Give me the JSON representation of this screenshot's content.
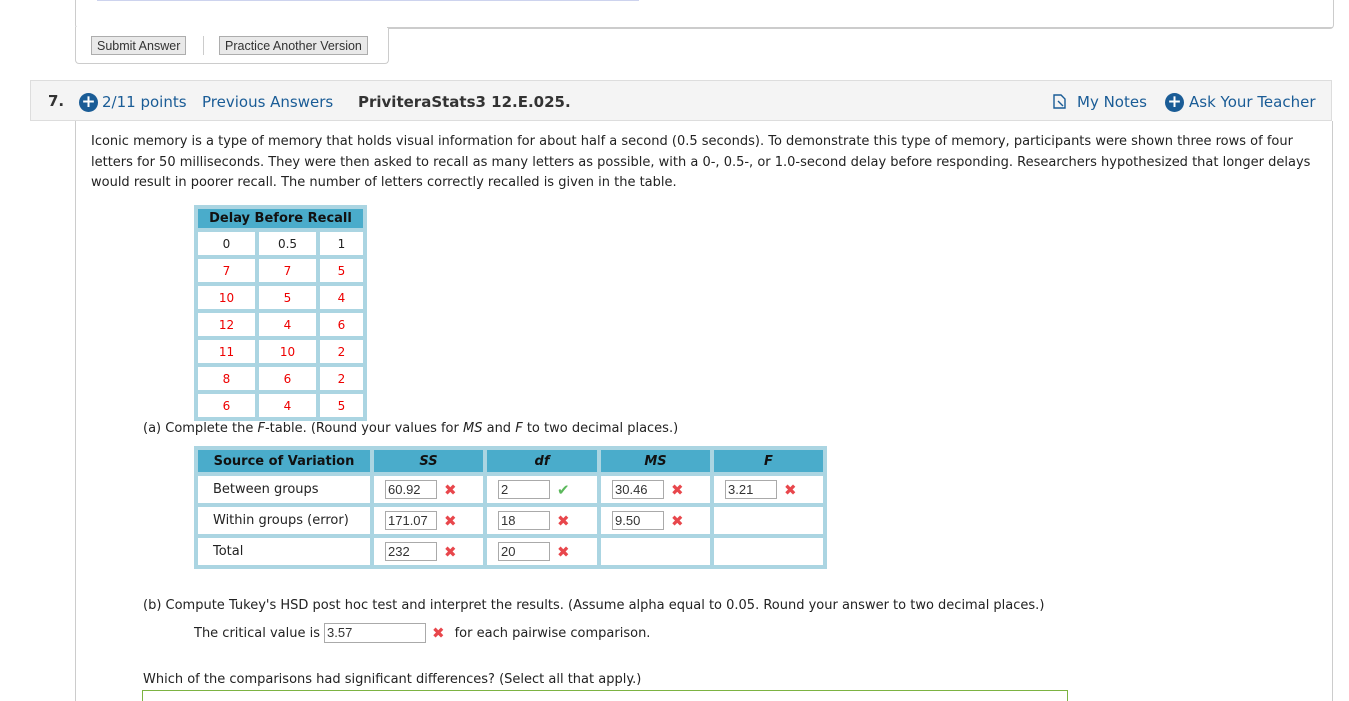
{
  "previous_question": {
    "buttons": {
      "submit": "Submit Answer",
      "practice": "Practice Another Version"
    }
  },
  "question": {
    "number": "7.",
    "points": "2/11 points",
    "previous_answers": "Previous Answers",
    "title": "PriviteraStats3 12.E.025.",
    "my_notes": "My Notes",
    "ask_teacher": "Ask Your Teacher",
    "intro": "Iconic memory is a type of memory that holds visual information for about half a second (0.5 seconds). To demonstrate this type of memory, participants were shown three rows of four letters for 50 milliseconds. They were then asked to recall as many letters as possible, with a 0-, 0.5-, or 1.0-second delay before responding. Researchers hypothesized that longer delays would result in poorer recall. The number of letters correctly recalled is given in the table."
  },
  "delay_table": {
    "title": "Delay Before Recall",
    "headers": [
      "0",
      "0.5",
      "1"
    ],
    "rows": [
      [
        "7",
        "7",
        "5"
      ],
      [
        "10",
        "5",
        "4"
      ],
      [
        "12",
        "4",
        "6"
      ],
      [
        "11",
        "10",
        "2"
      ],
      [
        "8",
        "6",
        "2"
      ],
      [
        "6",
        "4",
        "5"
      ]
    ]
  },
  "part_a": {
    "prefix": "(a) Complete the ",
    "f_italic": "F",
    "mid1": "-table. (Round your values for ",
    "ms_italic": "MS",
    "mid2": " and ",
    "f2_italic": "F",
    "suffix": " to two decimal places.)"
  },
  "f_table": {
    "headers": [
      "Source of Variation",
      "SS",
      "df",
      "MS",
      "F"
    ],
    "rows": [
      {
        "label": "Between groups",
        "ss": "60.92",
        "ss_status": "incorrect",
        "df": "2",
        "df_status": "correct",
        "ms": "30.46",
        "ms_status": "incorrect",
        "f": "3.21",
        "f_status": "incorrect"
      },
      {
        "label": "Within groups (error)",
        "ss": "171.07",
        "ss_status": "incorrect",
        "df": "18",
        "df_status": "incorrect",
        "ms": "9.50",
        "ms_status": "incorrect"
      },
      {
        "label": "Total",
        "ss": "232",
        "ss_status": "incorrect",
        "df": "20",
        "df_status": "incorrect"
      }
    ]
  },
  "part_b": {
    "text": "(b) Compute Tukey's HSD post hoc test and interpret the results. (Assume alpha equal to 0.05. Round your answer to two decimal places.)",
    "critical_prefix": "The critical value is",
    "critical_value": "3.57",
    "critical_status": "incorrect",
    "critical_suffix": "for each pairwise comparison.",
    "which": "Which of the comparisons had significant differences? (Select all that apply.)"
  },
  "colors": {
    "link": "#1a5c96",
    "table_header": "#4aaccb",
    "table_border": "#abd5e2",
    "incorrect": "#e8474c",
    "correct": "#5bb85b",
    "data_red": "#ee0000"
  }
}
